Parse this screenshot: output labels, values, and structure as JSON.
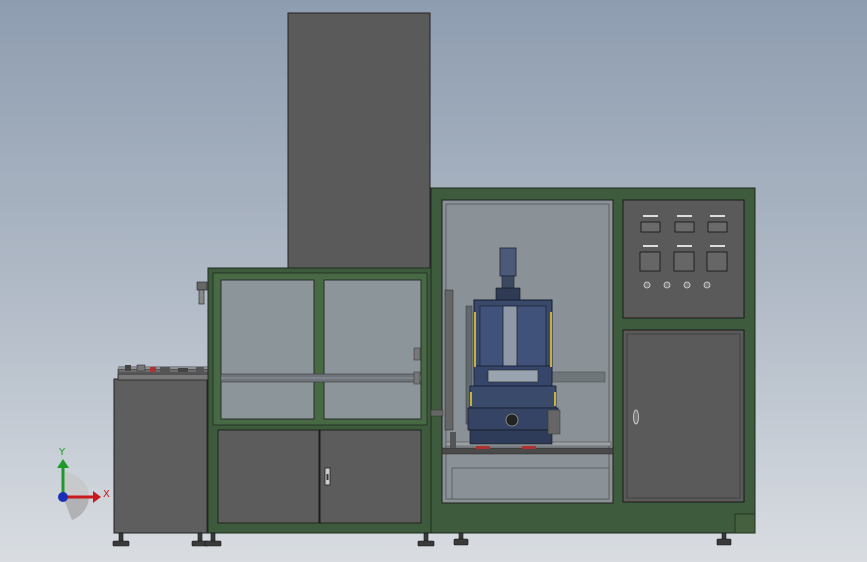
{
  "triad": {
    "x_label": "X",
    "y_label": "Y",
    "x_color": "#c8191e",
    "y_color": "#1f9a2a",
    "z_color": "#1a2fb8"
  },
  "control_panel": {
    "button_count_top": 3,
    "button_count_middle": 3,
    "indicator_count": 4
  }
}
